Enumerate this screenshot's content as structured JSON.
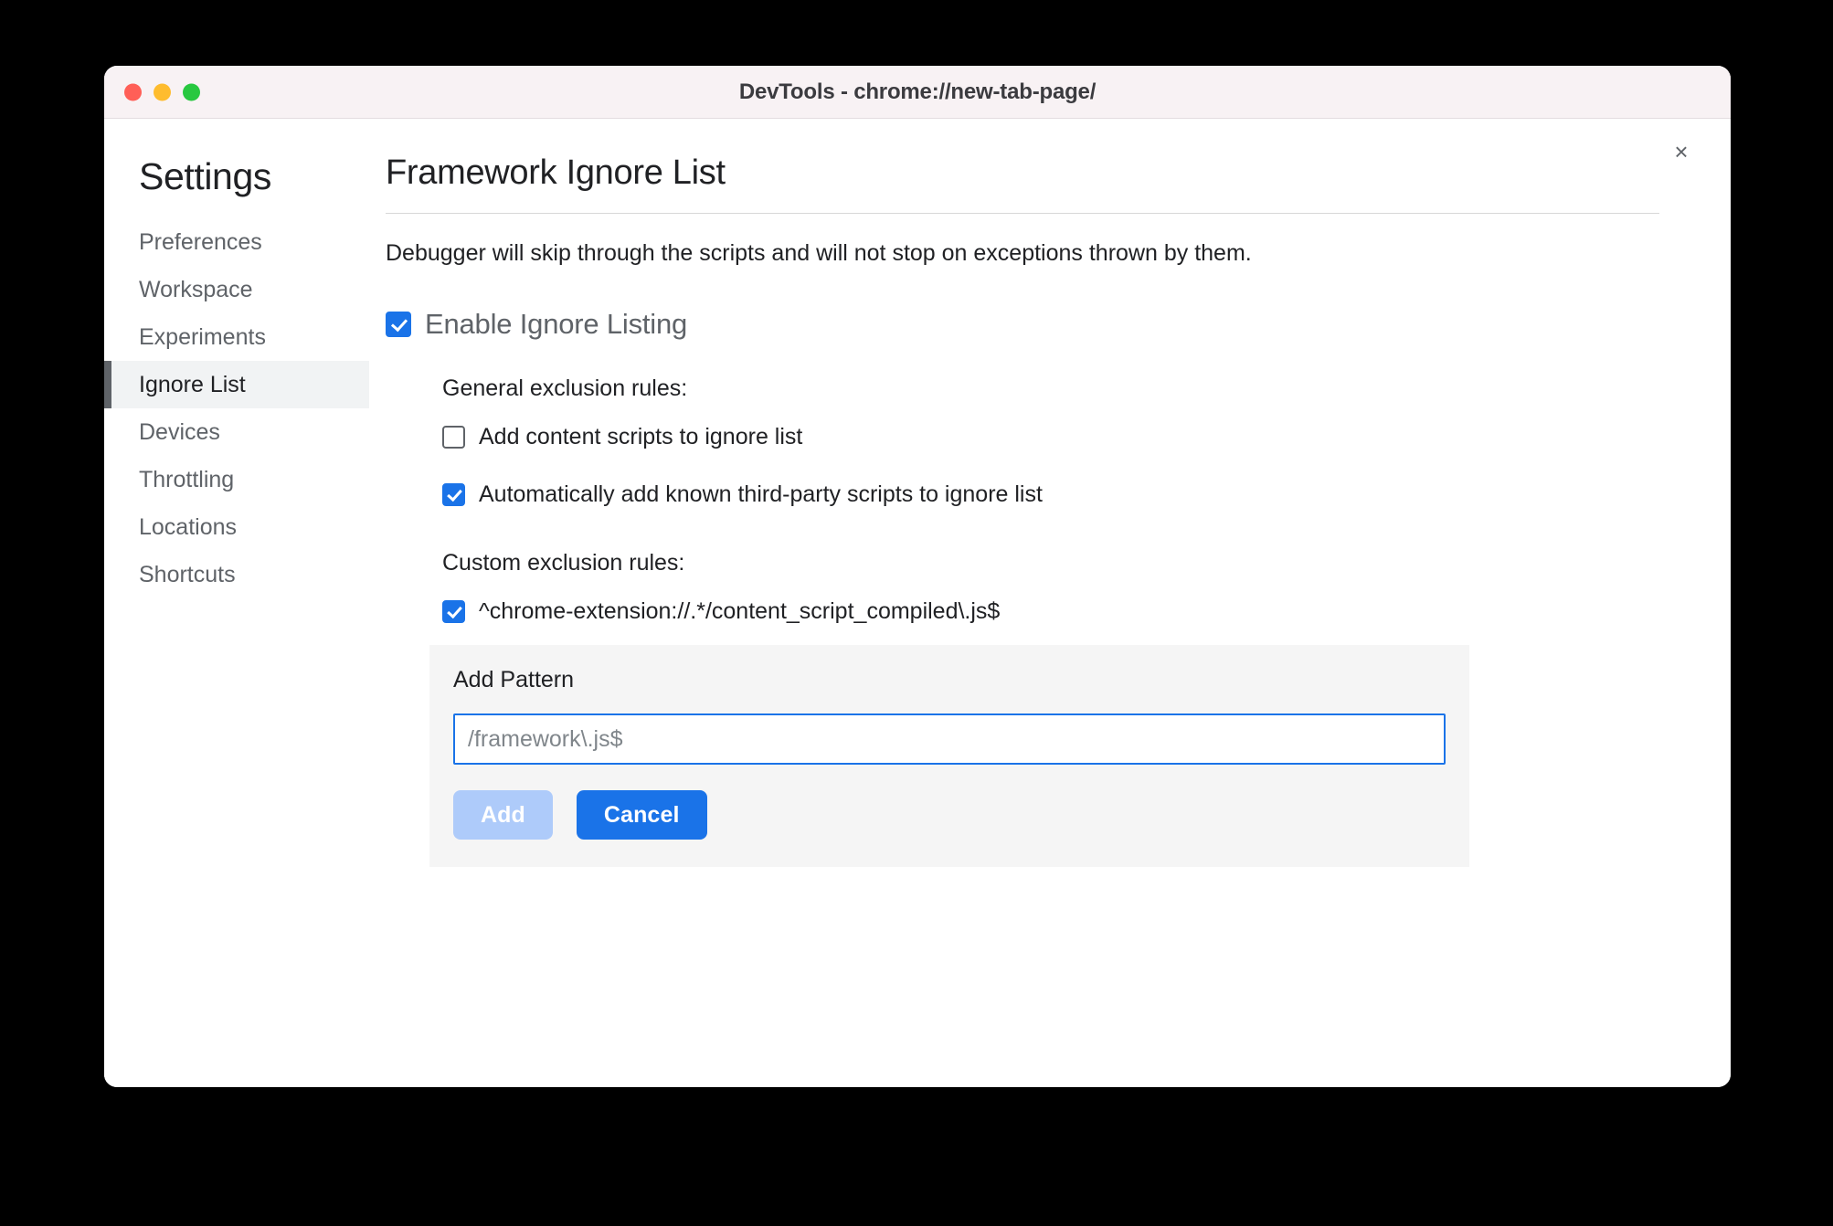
{
  "window": {
    "title": "DevTools - chrome://new-tab-page/",
    "traffic_lights": [
      "close",
      "minimize",
      "maximize"
    ],
    "close_icon": "×"
  },
  "sidebar": {
    "title": "Settings",
    "items": [
      {
        "label": "Preferences",
        "selected": false
      },
      {
        "label": "Workspace",
        "selected": false
      },
      {
        "label": "Experiments",
        "selected": false
      },
      {
        "label": "Ignore List",
        "selected": true
      },
      {
        "label": "Devices",
        "selected": false
      },
      {
        "label": "Throttling",
        "selected": false
      },
      {
        "label": "Locations",
        "selected": false
      },
      {
        "label": "Shortcuts",
        "selected": false
      }
    ]
  },
  "main": {
    "page_title": "Framework Ignore List",
    "description": "Debugger will skip through the scripts and will not stop on exceptions thrown by them.",
    "enable_toggle": {
      "label": "Enable Ignore Listing",
      "checked": true
    },
    "general_rules": {
      "heading": "General exclusion rules:",
      "items": [
        {
          "label": "Add content scripts to ignore list",
          "checked": false
        },
        {
          "label": "Automatically add known third-party scripts to ignore list",
          "checked": true
        }
      ]
    },
    "custom_rules": {
      "heading": "Custom exclusion rules:",
      "items": [
        {
          "label": "^chrome-extension://.*/content_script_compiled\\.js$",
          "checked": true
        }
      ]
    },
    "add_pattern": {
      "title": "Add Pattern",
      "input_value": "",
      "input_placeholder": "/framework\\.js$",
      "add_label": "Add",
      "cancel_label": "Cancel",
      "add_disabled": true
    }
  },
  "colors": {
    "accent": "#1a73e8",
    "accent_disabled": "#aecbfa",
    "selected_bg": "#f1f3f4",
    "panel_bg": "#f5f5f5",
    "titlebar_bg": "#f8f2f4",
    "traffic_red": "#ff5f57",
    "traffic_yellow": "#febc2e",
    "traffic_green": "#28c840"
  }
}
